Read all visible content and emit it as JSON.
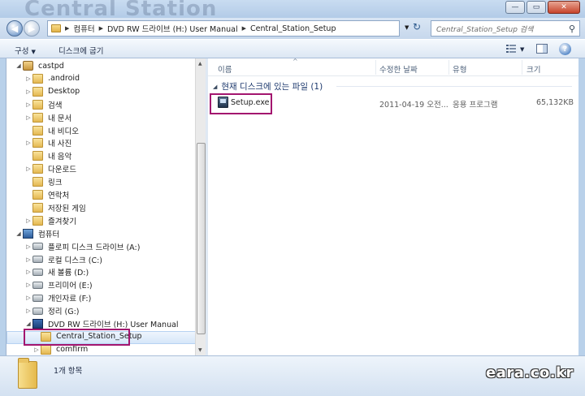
{
  "window": {
    "background_title": "Central Station",
    "minimize_glyph": "—",
    "maximize_glyph": "▭",
    "close_glyph": "✕"
  },
  "address": {
    "crumbs": [
      "컴퓨터",
      "DVD RW 드라이브 (H:) User Manual",
      "Central_Station_Setup"
    ],
    "search_placeholder": "Central_Station_Setup 검색"
  },
  "toolbar": {
    "organize_label": "구성",
    "burn_label": "디스크에 굽기",
    "help_glyph": "?"
  },
  "nav_tree": [
    {
      "label": "castpd",
      "icon": "user-folder-icon",
      "expander": "◢",
      "level": 0
    },
    {
      "label": ".android",
      "icon": "folder-icon",
      "expander": "▷",
      "level": 1
    },
    {
      "label": "Desktop",
      "icon": "folder-icon",
      "expander": "▷",
      "level": 1
    },
    {
      "label": "검색",
      "icon": "search-folder-icon",
      "expander": "▷",
      "level": 1
    },
    {
      "label": "내 문서",
      "icon": "documents-icon",
      "expander": "▷",
      "level": 1
    },
    {
      "label": "내 비디오",
      "icon": "videos-icon",
      "expander": "",
      "level": 1
    },
    {
      "label": "내 사진",
      "icon": "pictures-icon",
      "expander": "▷",
      "level": 1
    },
    {
      "label": "내 음악",
      "icon": "music-icon",
      "expander": "",
      "level": 1
    },
    {
      "label": "다운로드",
      "icon": "downloads-icon",
      "expander": "▷",
      "level": 1
    },
    {
      "label": "링크",
      "icon": "links-icon",
      "expander": "",
      "level": 1
    },
    {
      "label": "연락처",
      "icon": "contacts-icon",
      "expander": "",
      "level": 1
    },
    {
      "label": "저장된 게임",
      "icon": "saved-games-icon",
      "expander": "",
      "level": 1
    },
    {
      "label": "즐겨찾기",
      "icon": "favorites-icon",
      "expander": "▷",
      "level": 1
    },
    {
      "label": "컴퓨터",
      "icon": "computer-icon",
      "expander": "◢",
      "level": 0
    },
    {
      "label": "플로피 디스크 드라이브 (A:)",
      "icon": "floppy-drive-icon",
      "expander": "▷",
      "level": 1
    },
    {
      "label": "로컬 디스크 (C:)",
      "icon": "local-disk-icon",
      "expander": "▷",
      "level": 1
    },
    {
      "label": "새 볼륨 (D:)",
      "icon": "drive-icon",
      "expander": "▷",
      "level": 1
    },
    {
      "label": "프리미어 (E:)",
      "icon": "drive-icon",
      "expander": "▷",
      "level": 1
    },
    {
      "label": "개인자료 (F:)",
      "icon": "drive-icon",
      "expander": "▷",
      "level": 1
    },
    {
      "label": "정리 (G:)",
      "icon": "drive-icon",
      "expander": "▷",
      "level": 1
    },
    {
      "label": "DVD RW 드라이브 (H:) User Manual",
      "icon": "dvd-drive-icon",
      "expander": "◢",
      "level": 1
    },
    {
      "label": "Central_Station_Setup",
      "icon": "folder-icon",
      "expander": "",
      "level": 2,
      "selected": true
    },
    {
      "label": "comfirm",
      "icon": "folder-icon",
      "expander": "▷",
      "level": 2
    }
  ],
  "columns": {
    "name": "이름",
    "date": "수정한 날짜",
    "type": "유형",
    "size": "크기"
  },
  "group_label": "현재 디스크에 있는 파일 (1)",
  "files": [
    {
      "name": "Setup.exe",
      "date": "2011-04-19 오전...",
      "type": "응용 프로그램",
      "size": "65,132KB"
    }
  ],
  "status": {
    "item_count": "1개 항목"
  },
  "watermark": "eara.co.kr",
  "colors": {
    "highlight_box": "#a3166f",
    "selection": "#d6e7f9",
    "frame": "#b9d1ea"
  }
}
